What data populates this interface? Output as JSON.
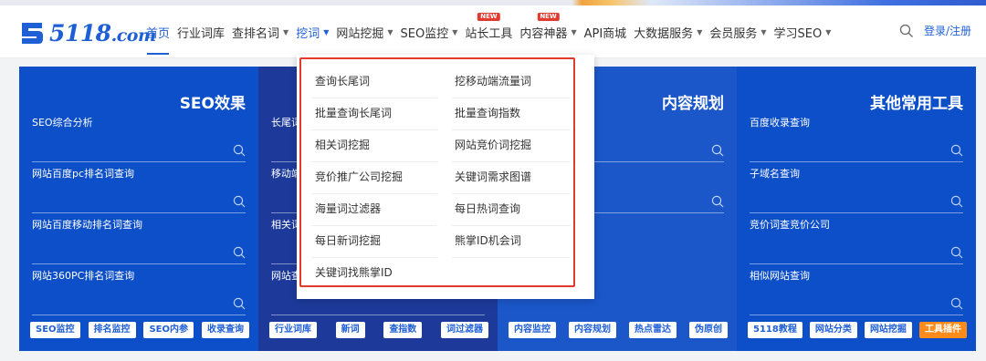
{
  "logo": {
    "text": "5118",
    "domain": ".com",
    "color": "#1f5fd6"
  },
  "nav": [
    {
      "label": "首页",
      "caret": false
    },
    {
      "label": "行业词库",
      "caret": false
    },
    {
      "label": "查排名词",
      "caret": true
    },
    {
      "label": "挖词",
      "caret": true,
      "active": true
    },
    {
      "label": "网站挖掘",
      "caret": true
    },
    {
      "label": "SEO监控",
      "caret": true
    },
    {
      "label": "站长工具",
      "caret": false,
      "badge": "NEW"
    },
    {
      "label": "内容神器",
      "caret": true,
      "badge": "NEW"
    },
    {
      "label": "API商城",
      "caret": false
    },
    {
      "label": "大数据服务",
      "caret": true
    },
    {
      "label": "会员服务",
      "caret": true
    },
    {
      "label": "学习SEO",
      "caret": true
    }
  ],
  "header": {
    "login": "登录/注册",
    "search_icon": "search-icon"
  },
  "panels": [
    {
      "title": "SEO效果",
      "tools": [
        "SEO综合分析",
        "网站百度pc排名词查询",
        "网站百度移动排名词查询",
        "网站360PC排名词查询"
      ],
      "buttons": [
        "SEO监控",
        "排名监控",
        "SEO内参",
        "收录查询"
      ]
    },
    {
      "title": "",
      "tools": [
        "长尾词",
        "移动端",
        "相关词",
        "网站查"
      ],
      "buttons": [
        "行业词库",
        "新词",
        "查指数",
        "词过滤器"
      ]
    },
    {
      "title": "内容规划",
      "tools": [
        "",
        "",
        "",
        ""
      ],
      "buttons": [
        "内容监控",
        "内容规划",
        "热点雷达",
        "伪原创"
      ]
    },
    {
      "title": "其他常用工具",
      "tools": [
        "百度收录查询",
        "子域名查询",
        "竞价词查竞价公司",
        "相似网站查询"
      ],
      "buttons": [
        "5118教程",
        "网站分类",
        "网站挖掘",
        "工具插件"
      ]
    }
  ],
  "dropdown": {
    "left": [
      "查询长尾词",
      "批量查询长尾词",
      "相关词挖掘",
      "竞价推广公司挖掘",
      "海量词过滤器",
      "每日新词挖掘",
      "关键词找熊掌ID"
    ],
    "right": [
      "挖移动端流量词",
      "批量查询指数",
      "网站竞价词挖掘",
      "关键词需求图谱",
      "每日热词查询",
      "熊掌ID机会词"
    ]
  },
  "colors": {
    "accent": "#1f5fd6",
    "highlight": "#e23a2f",
    "orange": "#ff8c1a"
  }
}
